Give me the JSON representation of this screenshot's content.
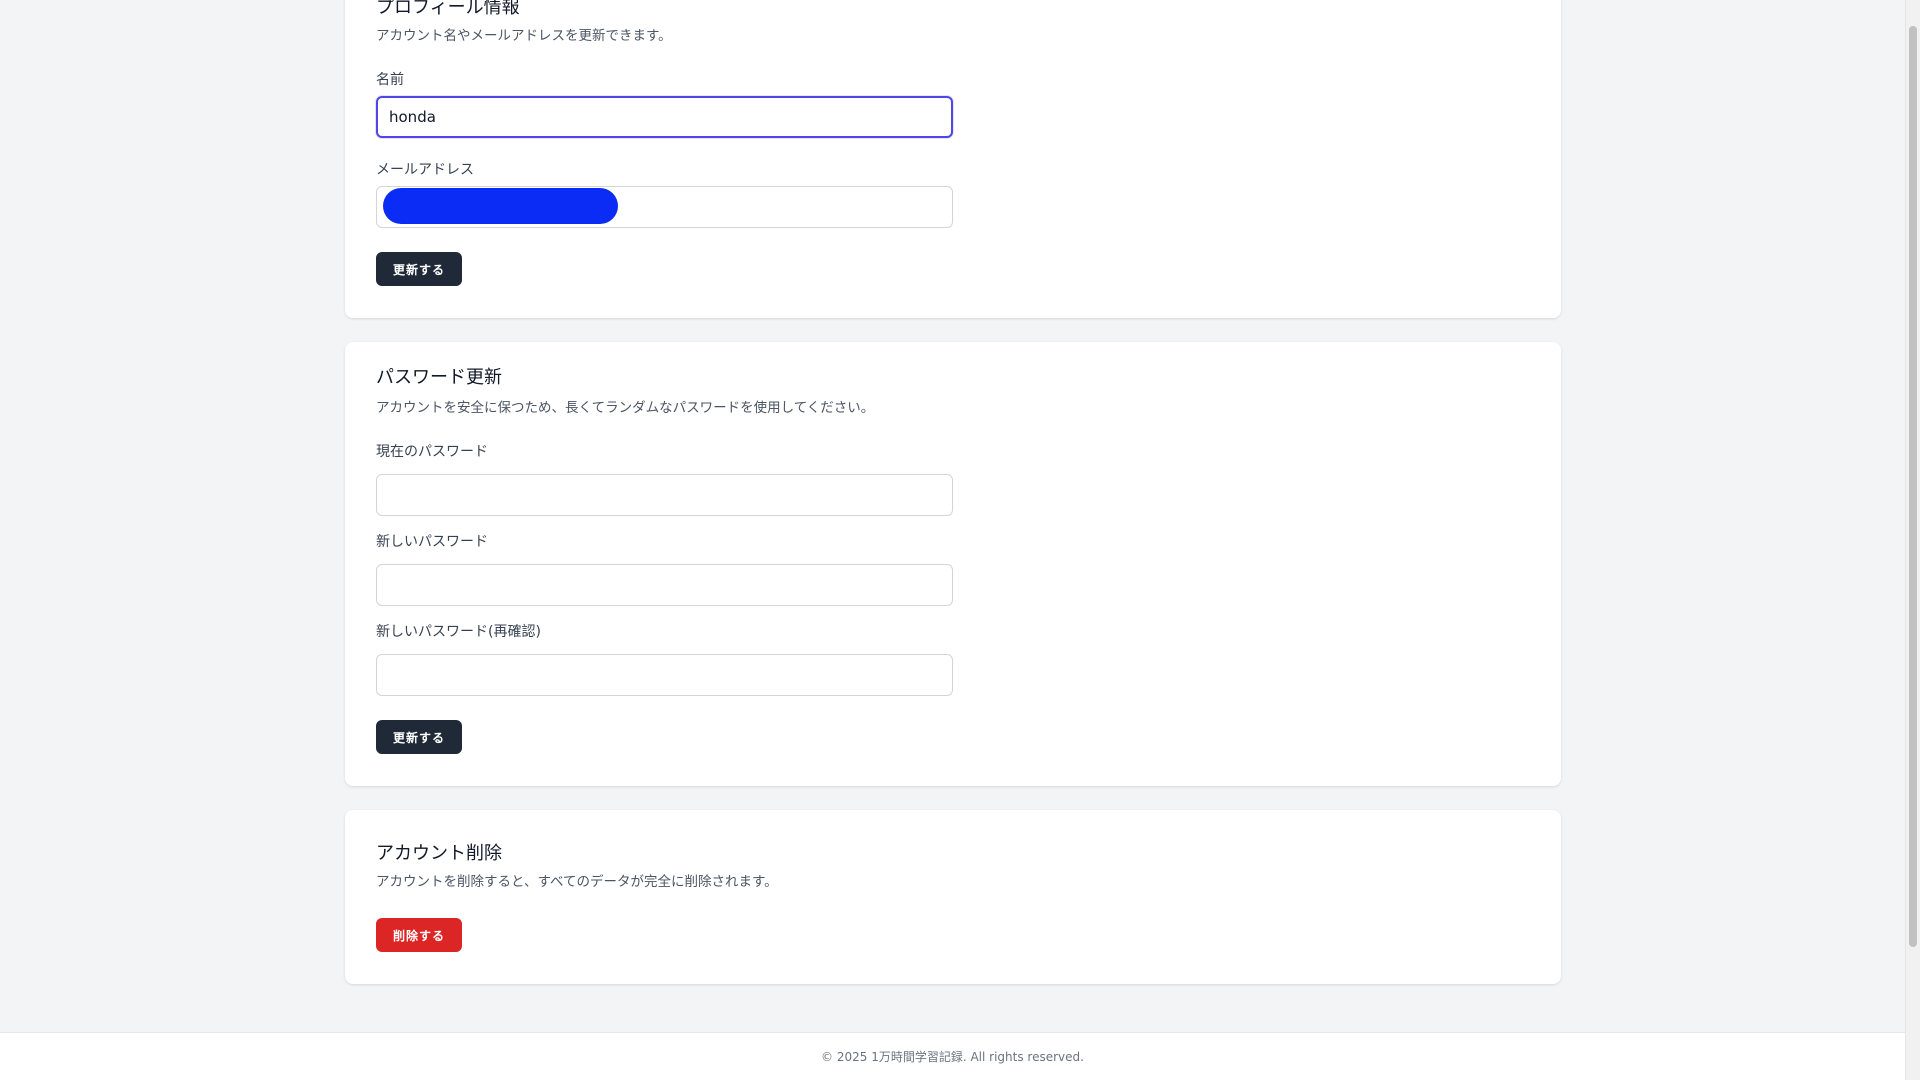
{
  "profile": {
    "title": "プロフィール情報",
    "description": "アカウント名やメールアドレスを更新できます。",
    "name_label": "名前",
    "name_value": "honda",
    "email_label": "メールアドレス",
    "email_value": "",
    "submit_label": "更新する"
  },
  "password": {
    "title": "パスワード更新",
    "description": "アカウントを安全に保つため、長くてランダムなパスワードを使用してください。",
    "current_label": "現在のパスワード",
    "current_value": "",
    "new_label": "新しいパスワード",
    "new_value": "",
    "confirm_label": "新しいパスワード(再確認)",
    "confirm_value": "",
    "submit_label": "更新する"
  },
  "delete_account": {
    "title": "アカウント削除",
    "description": "アカウントを削除すると、すべてのデータが完全に削除されます。",
    "submit_label": "削除する"
  },
  "footer": {
    "copyright": "© 2025 1万時間学習記録. All rights reserved."
  },
  "scroll": {
    "position_fraction": 0.17
  },
  "colors": {
    "primary_button": "#1f2937",
    "danger_button": "#dc2626",
    "focus_ring": "#4f46e5",
    "email_redaction": "#0a2cf5",
    "page_background": "#f3f4f6"
  }
}
